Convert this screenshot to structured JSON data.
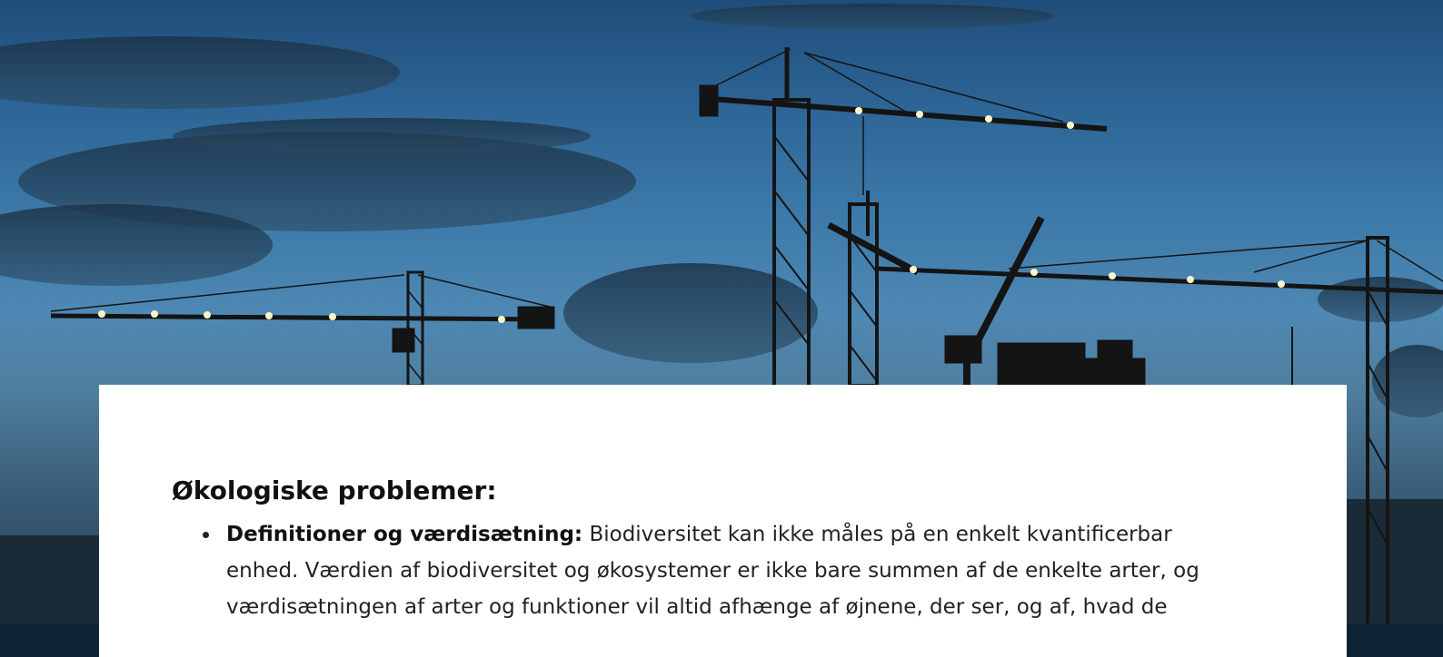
{
  "hero": {
    "image_description_icon": "construction-cranes-dusk-icon"
  },
  "section": {
    "heading": "Økologiske problemer:",
    "items": [
      {
        "term": "Definitioner og værdisætning:",
        "text": " Biodiversitet kan ikke måles på en enkelt kvantificerbar enhed. Værdien af biodiversitet og økosystemer er ikke bare summen af de enkelte arter, og værdisætningen af arter og funktioner vil altid afhænge af øjnene, der ser, og af, hvad de"
      }
    ]
  },
  "colors": {
    "sky_top": "#1f4d7a",
    "sky_mid": "#4e88b4",
    "card_bg": "#ffffff",
    "text": "#222222"
  }
}
